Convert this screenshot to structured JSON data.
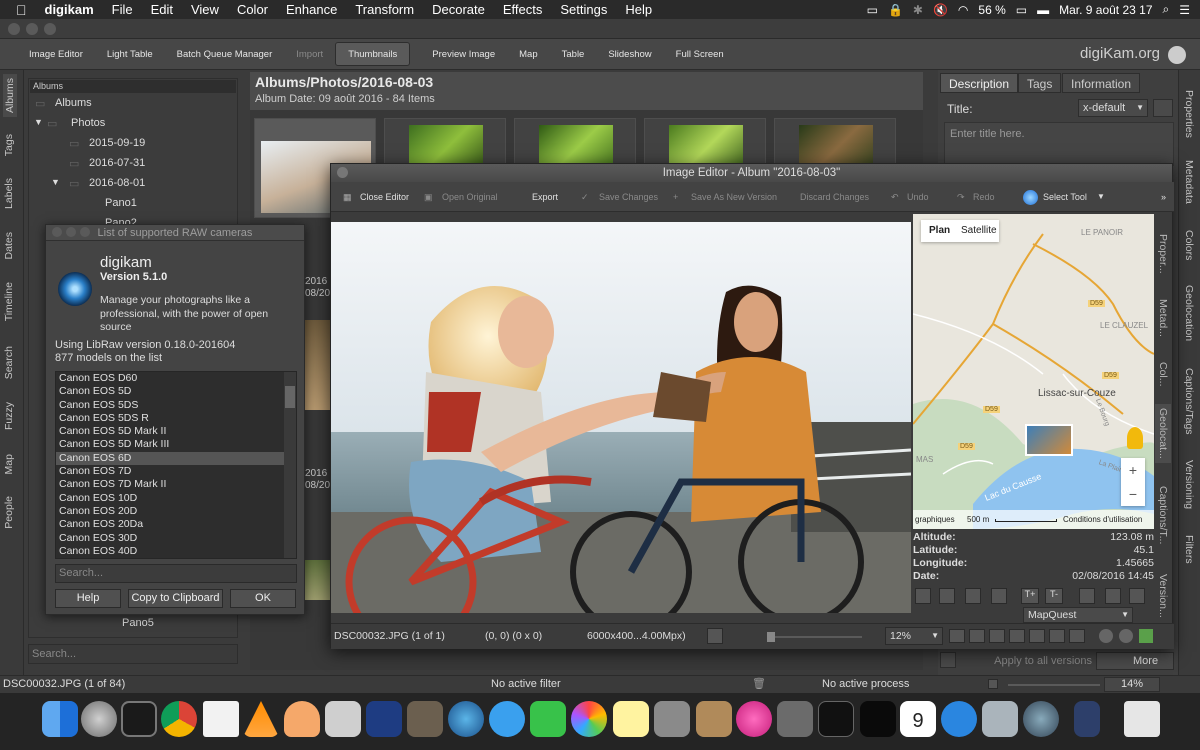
{
  "menubar": {
    "app": "digikam",
    "items": [
      "File",
      "Edit",
      "View",
      "Color",
      "Enhance",
      "Transform",
      "Decorate",
      "Effects",
      "Settings",
      "Help"
    ],
    "battery": "56 %",
    "clock": "Mar. 9 août  23 17"
  },
  "toolbar": {
    "items": [
      {
        "label": "Image Editor",
        "state": "normal"
      },
      {
        "label": "Light Table",
        "state": "normal"
      },
      {
        "label": "Batch Queue Manager",
        "state": "normal"
      },
      {
        "label": "Import",
        "state": "disabled"
      },
      {
        "label": "Thumbnails",
        "state": "active"
      },
      {
        "label": "Preview Image",
        "state": "normal"
      },
      {
        "label": "Map",
        "state": "normal"
      },
      {
        "label": "Table",
        "state": "normal"
      },
      {
        "label": "Slideshow",
        "state": "normal"
      },
      {
        "label": "Full Screen",
        "state": "normal"
      }
    ],
    "brand": "digiKam.org"
  },
  "left_tabs": [
    "Albums",
    "Tags",
    "Labels",
    "Dates",
    "Timeline",
    "Search",
    "Fuzzy",
    "Map",
    "People"
  ],
  "tree": {
    "header": "Albums",
    "nodes": [
      "Albums",
      "Photos",
      "2015-09-19",
      "2016-07-31",
      "2016-08-01",
      "Pano1",
      "Pano2",
      "Pano5"
    ],
    "search_placeholder": "Search..."
  },
  "album": {
    "title": "Albums/Photos/2016-08-03",
    "subtitle": "Album Date: 09 août 2016 - 84 Items",
    "partial_labels": [
      "2016",
      "08/20",
      "2016",
      "08/20"
    ]
  },
  "right_panel": {
    "tabs": [
      "Description",
      "Tags",
      "Information"
    ],
    "title_label": "Title:",
    "language": "x-default",
    "title_placeholder": "Enter title here.",
    "apply_button": "Apply to all versions",
    "more_button": "More",
    "side_tabs": [
      "Properties",
      "Metadata",
      "Colors",
      "Geolocation",
      "Captions/Tags",
      "Versioning",
      "Filters"
    ]
  },
  "status": {
    "file": "DSC00032.JPG (1 of 84)",
    "filter": "No active filter",
    "process": "No active process",
    "zoom": "14%"
  },
  "dialog": {
    "title": "List of supported RAW cameras",
    "app_name": "digikam",
    "version": "Version 5.1.0",
    "description": "Manage your photographs like a professional, with the power of open source",
    "libraw": "Using LibRaw version 0.18.0-201604",
    "models": "877 models on the list",
    "cameras": [
      "Canon EOS D60",
      "Canon EOS 5D",
      "Canon EOS 5DS",
      "Canon EOS 5DS R",
      "Canon EOS 5D Mark II",
      "Canon EOS 5D Mark III",
      "Canon EOS 6D",
      "Canon EOS 7D",
      "Canon EOS 7D Mark II",
      "Canon EOS 10D",
      "Canon EOS 20D",
      "Canon EOS 20Da",
      "Canon EOS 30D",
      "Canon EOS 40D"
    ],
    "selected_index": 6,
    "search_placeholder": "Search...",
    "help_button": "Help",
    "copy_button": "Copy to Clipboard",
    "ok_button": "OK"
  },
  "editor": {
    "title": "Image Editor - Album \"2016-08-03\"",
    "tools": [
      {
        "label": "Close Editor",
        "state": "normal"
      },
      {
        "label": "Open Original",
        "state": "disabled"
      },
      {
        "label": "Export",
        "state": "normal"
      },
      {
        "label": "Save Changes",
        "state": "disabled"
      },
      {
        "label": "Save As New Version",
        "state": "disabled"
      },
      {
        "label": "Discard Changes",
        "state": "disabled"
      },
      {
        "label": "Undo",
        "state": "disabled"
      },
      {
        "label": "Redo",
        "state": "disabled"
      },
      {
        "label": "Select Tool",
        "state": "normal"
      }
    ],
    "map": {
      "plan": "Plan",
      "satellite": "Satellite",
      "labels": [
        "LE PANOIR",
        "D59",
        "LE CLAUZEL",
        "D59",
        "Lissac-sur-Couze",
        "D59",
        "D59",
        "MAS",
        "Lac du Causse",
        "Le Bourg",
        "La Plaine"
      ],
      "attrib": "graphiques",
      "scale": "500 m",
      "conditions": "Conditions d'utilisation",
      "provider": "MapQuest"
    },
    "geo": {
      "altitude_label": "Altitude:",
      "altitude": "123.08 m",
      "latitude_label": "Latitude:",
      "latitude": "45.1",
      "longitude_label": "Longitude:",
      "longitude": "1.45665",
      "date_label": "Date:",
      "date": "02/08/2016 14:45"
    },
    "status": {
      "file": "DSC00032.JPG (1 of 1)",
      "coords": "(0, 0) (0 x 0)",
      "size": "6000x400...4.00Mpx)",
      "zoom": "12%"
    },
    "side_tabs": [
      "Proper...",
      "Metad...",
      "Col...",
      "Geolocat...",
      "Captions/T...",
      "Version..."
    ]
  }
}
